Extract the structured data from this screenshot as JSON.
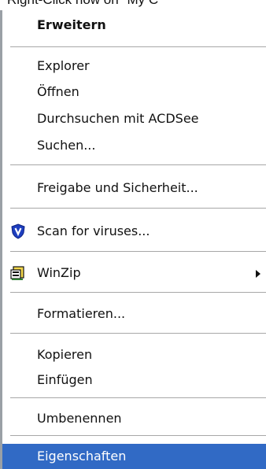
{
  "caption": "Right-Click now on \"My C",
  "menu": {
    "items": [
      {
        "label": "Erweitern"
      },
      {
        "label": "Explorer"
      },
      {
        "label": "Öffnen"
      },
      {
        "label": "Durchsuchen mit ACDSee"
      },
      {
        "label": "Suchen..."
      },
      {
        "label": "Freigabe und Sicherheit..."
      },
      {
        "label": "Scan for viruses...",
        "icon": "shield-icon"
      },
      {
        "label": "WinZip",
        "icon": "winzip-icon"
      },
      {
        "label": "Formatieren..."
      },
      {
        "label": "Kopieren"
      },
      {
        "label": "Einfügen"
      },
      {
        "label": "Umbenennen"
      },
      {
        "label": "Eigenschaften"
      }
    ]
  },
  "colors": {
    "selection": "#316ac5",
    "separator": "#a7a7a7"
  }
}
